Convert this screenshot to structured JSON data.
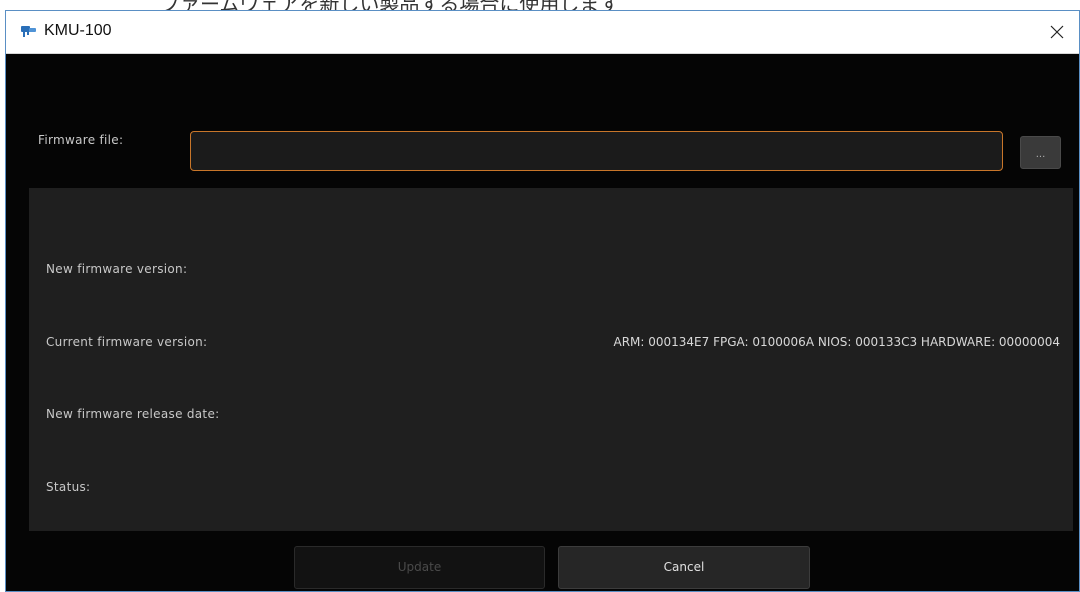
{
  "page_header_partial": "ファームウェアを新しい製品する場合に使用します",
  "window": {
    "title": "KMU-100",
    "icon": "app-device-icon",
    "close_glyph": "✕"
  },
  "firmware_file": {
    "label": "Firmware file:",
    "value": "",
    "placeholder": "",
    "browse_label": "..."
  },
  "info": {
    "new_version_label": "New firmware version:",
    "new_version_value": "",
    "current_version_label": "Current firmware version:",
    "current_version_value": "ARM: 000134E7 FPGA: 0100006A NIOS: 000133C3 HARDWARE: 00000004",
    "release_date_label": "New firmware release date:",
    "release_date_value": "",
    "status_label": "Status:",
    "status_value": ""
  },
  "buttons": {
    "update_label": "Update",
    "cancel_label": "Cancel"
  },
  "colors": {
    "accent_border": "#c8762a",
    "window_bg": "#050505",
    "panel_bg": "#1f1f1f"
  }
}
